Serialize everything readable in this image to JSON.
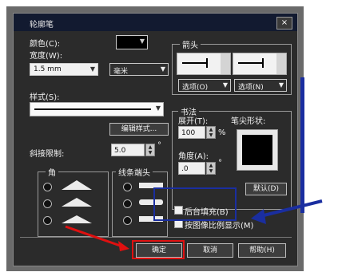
{
  "dialog": {
    "title": "轮廓笔",
    "close_label": "×"
  },
  "color": {
    "label": "颜色(C):"
  },
  "width": {
    "label": "宽度(W):",
    "value": "1.5 mm",
    "unit": "毫米"
  },
  "style": {
    "label": "样式(S):",
    "edit_button": "编辑样式..."
  },
  "miter": {
    "label": "斜接限制:",
    "value": "5.0",
    "unit_mark": "°"
  },
  "corners": {
    "label": "角"
  },
  "line_caps": {
    "label": "线条端头"
  },
  "arrows": {
    "label": "箭头",
    "option_left": "选项(O)",
    "option_right": "选项(N)"
  },
  "calligraphy": {
    "label": "书法",
    "stretch_label": "展开(T):",
    "stretch_value": "100",
    "stretch_unit": "%",
    "angle_label": "角度(A):",
    "angle_value": ".0",
    "angle_unit": "°",
    "nib_label": "笔尖形状:",
    "default_button": "默认(D)"
  },
  "checkboxes": {
    "behind_fill": "后台填充(B)",
    "scale_with_image": "按图像比例显示(M)"
  },
  "buttons": {
    "ok": "确定",
    "cancel": "取消",
    "help": "帮助(H)"
  },
  "colors": {
    "annotation_red": "#e01010",
    "annotation_blue": "#1a2ea0"
  }
}
